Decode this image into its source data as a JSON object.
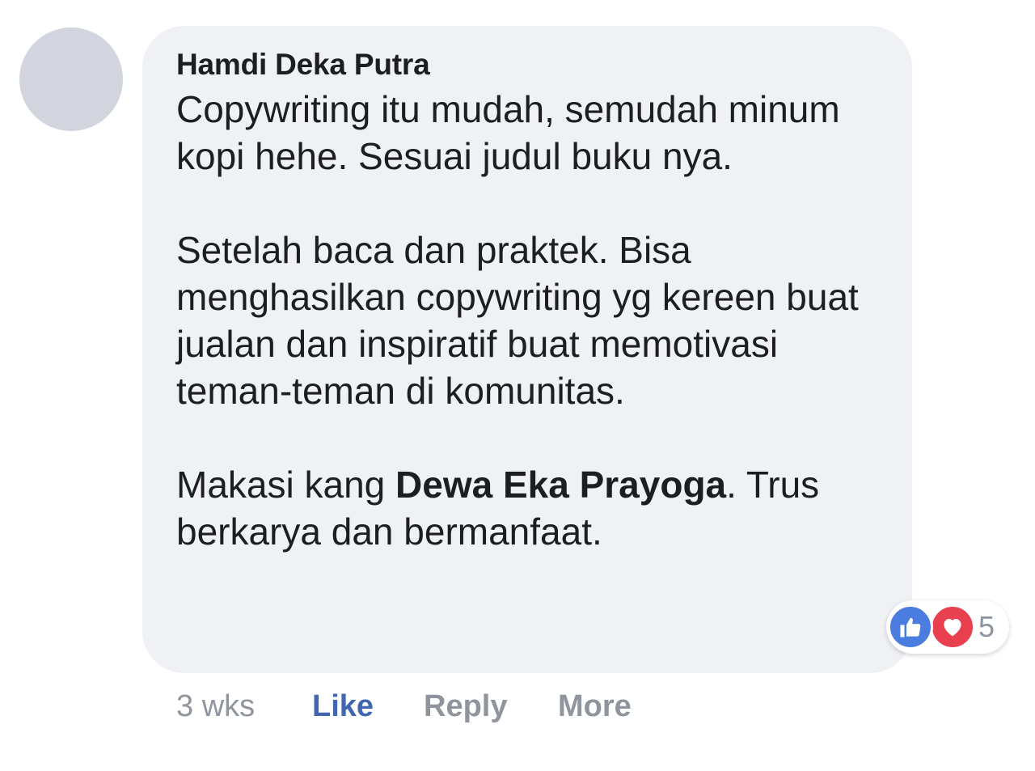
{
  "comment": {
    "author": "Hamdi Deka Putra",
    "paragraph1": "Copywriting itu mudah, semudah minum kopi hehe. Sesuai judul buku nya.",
    "paragraph2": "Setelah baca dan praktek. Bisa menghasilkan copywriting yg kereen buat jualan dan inspiratif buat memotivasi teman-teman di komunitas.",
    "paragraph3_before": "Makasi kang ",
    "mention": "Dewa Eka Prayoga",
    "paragraph3_after": ". Trus berkarya dan bermanfaat."
  },
  "reactions": {
    "icons": [
      "like-icon",
      "love-icon"
    ],
    "count": "5",
    "colors": {
      "like": "#4b7de0",
      "love": "#e8404e"
    }
  },
  "actions": {
    "time": "3 wks",
    "like": "Like",
    "reply": "Reply",
    "more": "More"
  },
  "colors": {
    "bubble": "#f0f1f4",
    "avatar": "#d2d5de",
    "link": "#4267b2",
    "muted": "#90949c"
  }
}
